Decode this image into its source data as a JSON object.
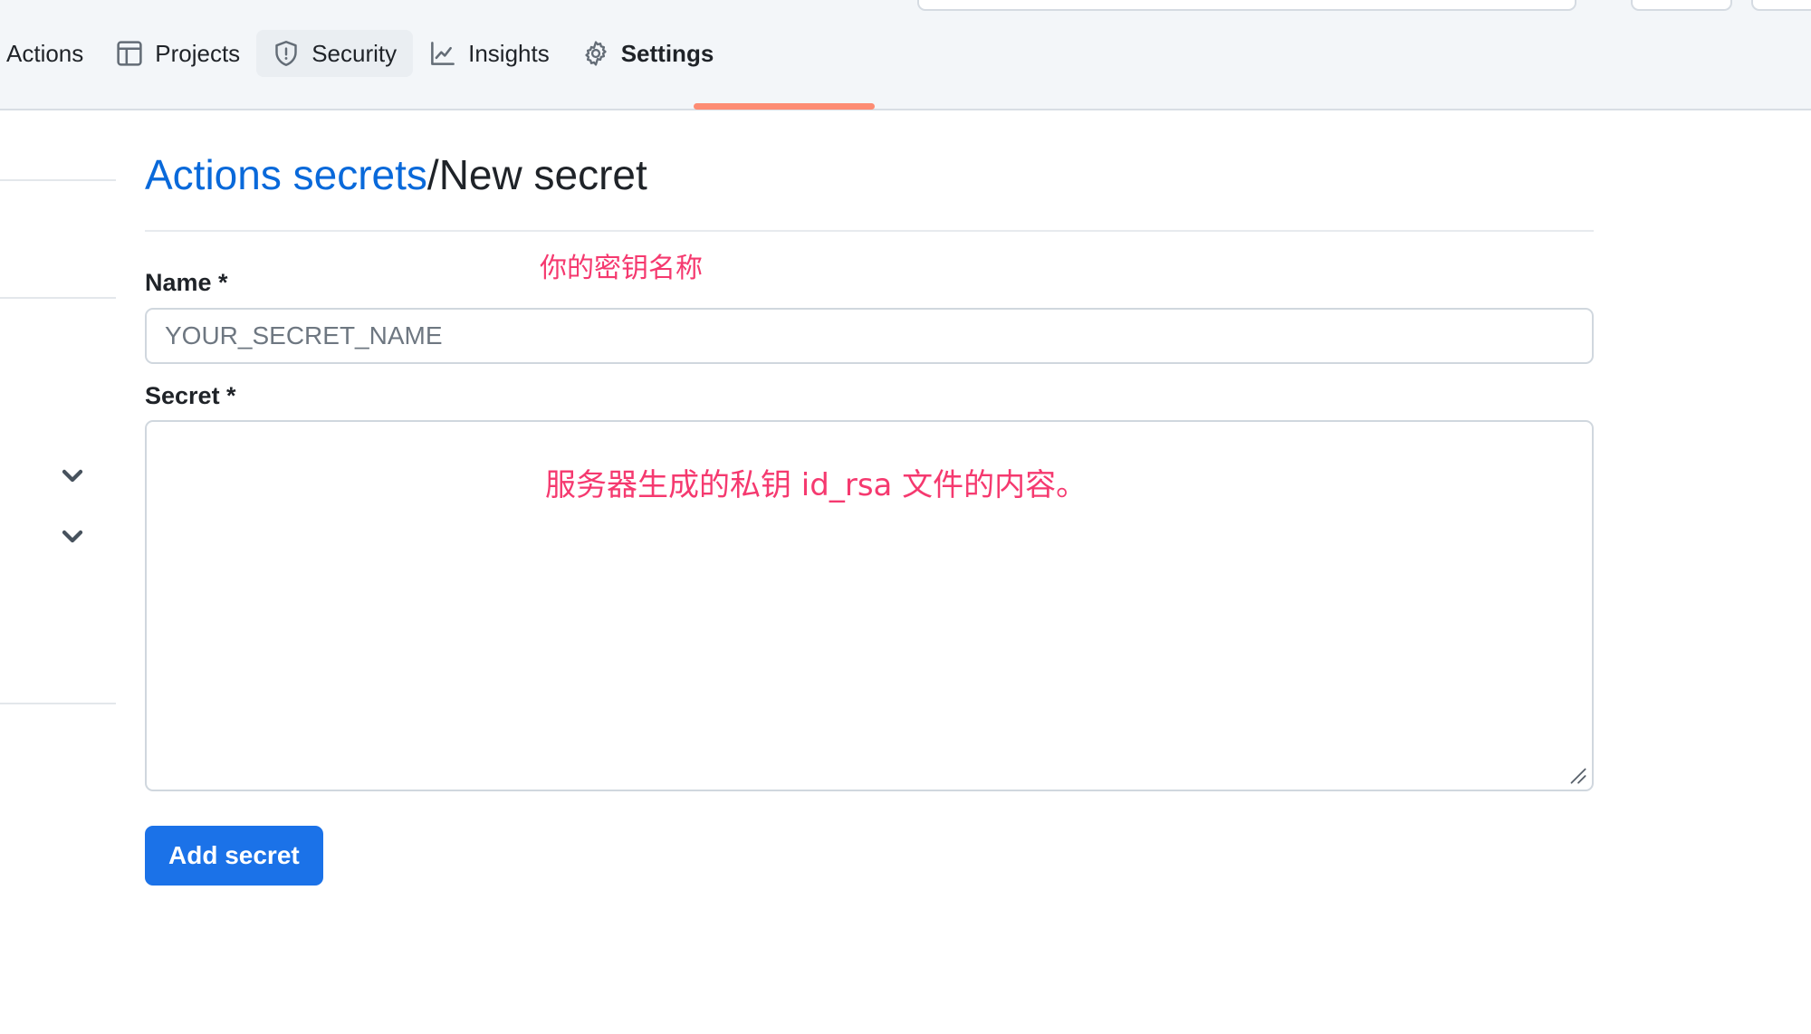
{
  "topnav": {
    "tabs": [
      {
        "label": "Actions",
        "icon": "play-circle-icon",
        "state": "clipped"
      },
      {
        "label": "Projects",
        "icon": "project-table-icon",
        "state": "normal"
      },
      {
        "label": "Security",
        "icon": "shield-alert-icon",
        "state": "hovered"
      },
      {
        "label": "Insights",
        "icon": "graph-icon",
        "state": "normal"
      },
      {
        "label": "Settings",
        "icon": "gear-icon",
        "state": "active"
      }
    ],
    "active_accent_color": "#fd8c73",
    "background_color": "#f3f6f9"
  },
  "sidebar": {
    "collapsed_sections": [
      {
        "icon": "chevron-down-icon"
      },
      {
        "icon": "chevron-down-icon"
      }
    ]
  },
  "page": {
    "breadcrumb_link": "Actions secrets",
    "breadcrumb_separator": "/",
    "breadcrumb_current": "New secret",
    "link_color": "#0969da"
  },
  "form": {
    "name_label": "Name *",
    "name_placeholder": "YOUR_SECRET_NAME",
    "name_value": "",
    "secret_label": "Secret *",
    "secret_value": "",
    "submit_label": "Add secret",
    "submit_color": "#1b72e8"
  },
  "annotations": {
    "color": "#f5396f",
    "name_note": "你的密钥名称",
    "secret_note": "服务器生成的私钥 id_rsa 文件的内容。"
  }
}
